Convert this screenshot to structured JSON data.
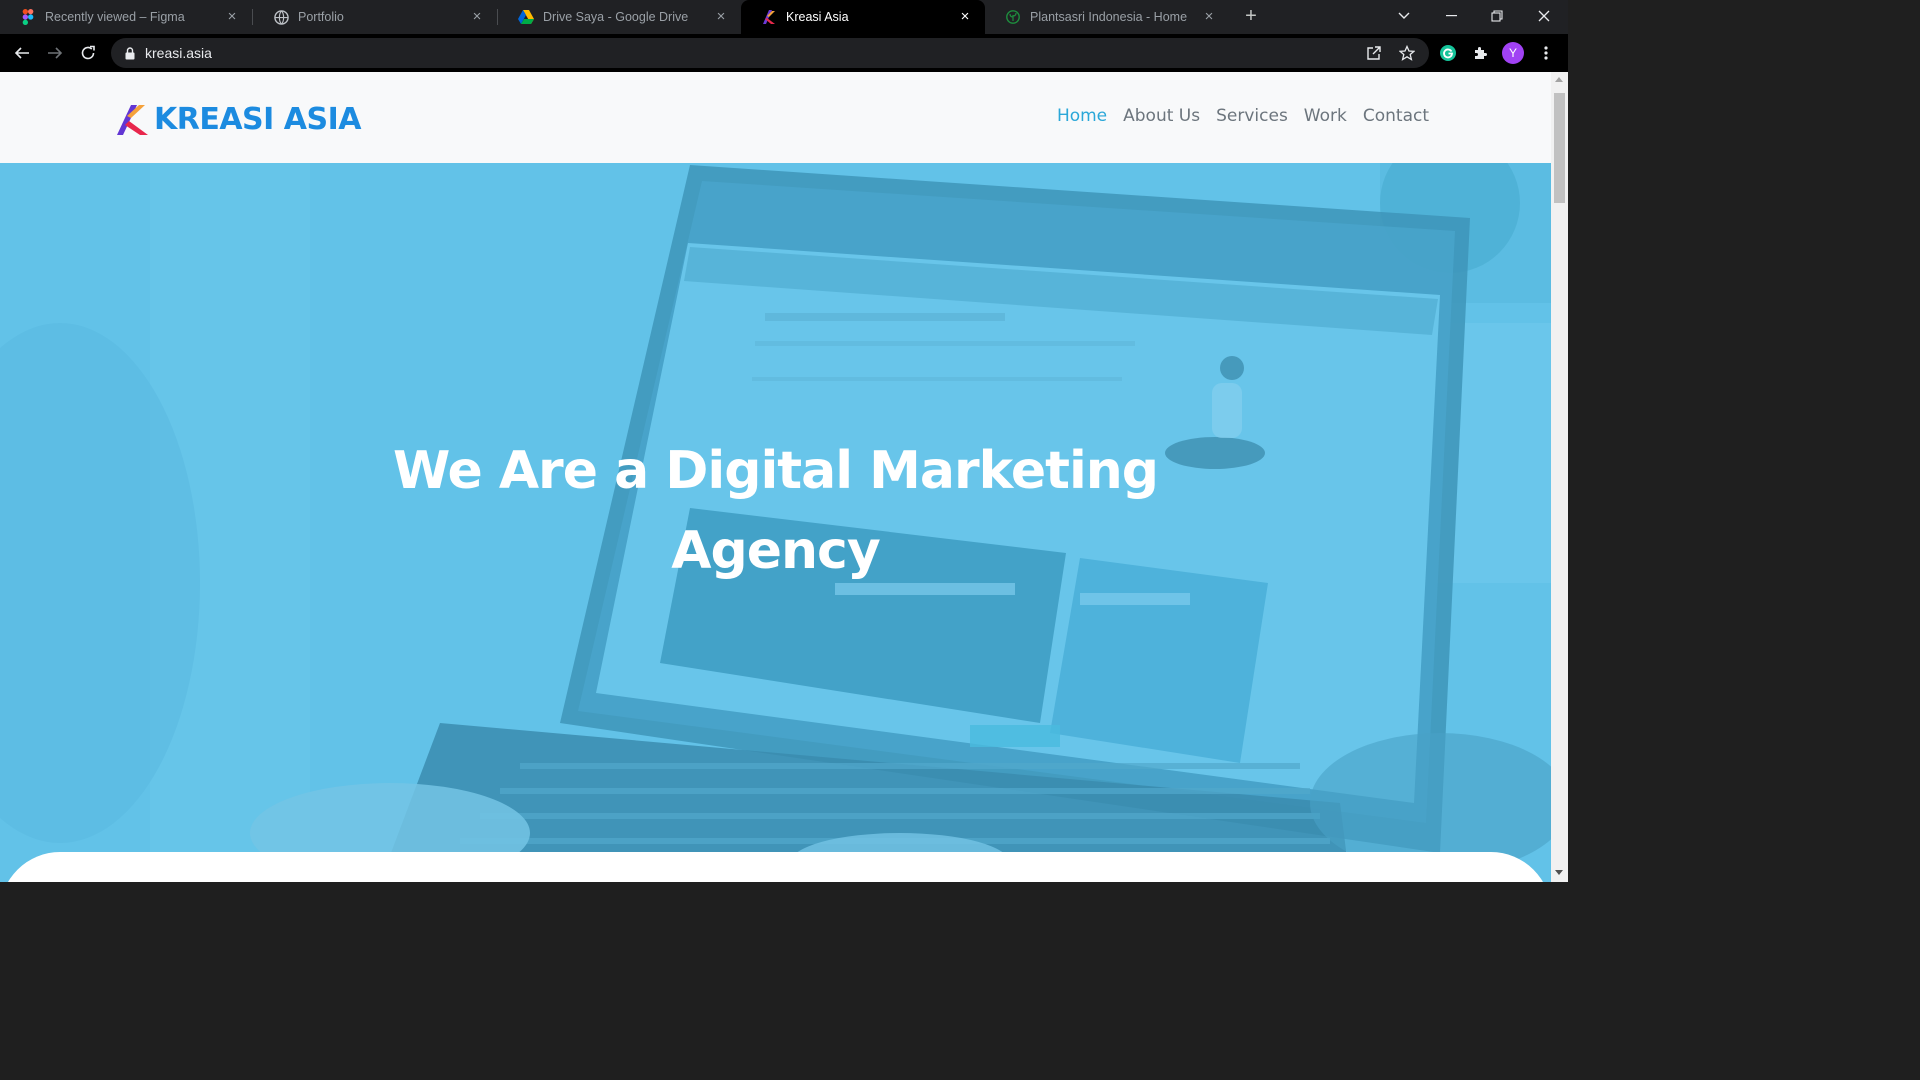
{
  "browser": {
    "tabs": [
      {
        "title": "Recently viewed – Figma",
        "icon": "figma-icon"
      },
      {
        "title": "Portfolio",
        "icon": "globe-icon"
      },
      {
        "title": "Drive Saya - Google Drive",
        "icon": "google-drive-icon"
      },
      {
        "title": "Kreasi Asia",
        "icon": "kreasi-asia-icon",
        "active": true
      },
      {
        "title": "Plantsasri Indonesia - Home",
        "icon": "plantsasri-icon"
      }
    ],
    "url": "kreasi.asia",
    "profile_initial": "Y"
  },
  "site": {
    "logo_text": "KREASI ASIA",
    "nav": [
      {
        "label": "Home",
        "active": true
      },
      {
        "label": "About Us"
      },
      {
        "label": "Services"
      },
      {
        "label": "Work"
      },
      {
        "label": "Contact"
      }
    ],
    "hero": {
      "title_line1": "We Are a Digital Marketing",
      "title_line2": "Agency"
    },
    "colors": {
      "brand_blue": "#1c8be0",
      "nav_active": "#2aa7d8",
      "hero_overlay": "#62c1e6"
    }
  }
}
